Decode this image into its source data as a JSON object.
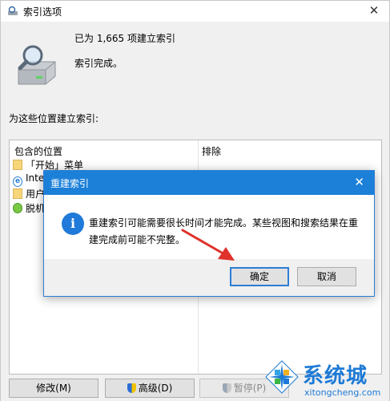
{
  "window": {
    "title": "索引选项",
    "close_glyph": "✕"
  },
  "index": {
    "count_text": "已为 1,665 项建立索引",
    "status_text": "索引完成。",
    "locations_heading": "为这些位置建立索引:"
  },
  "table": {
    "headers": {
      "included": "包含的位置",
      "excluded": "排除"
    },
    "rows": [
      {
        "icon": "folder-icon",
        "label": "「开始」菜单"
      },
      {
        "icon": "internet-explorer-icon",
        "label": "Inter"
      },
      {
        "icon": "folder-icon",
        "label": "用户"
      },
      {
        "icon": "offline-files-icon",
        "label": "脱机"
      }
    ]
  },
  "buttons": {
    "modify": "修改(M)",
    "advanced": "高级(D)",
    "pause": "暂停(P)"
  },
  "dialog": {
    "title": "重建索引",
    "close_glyph": "✕",
    "message": "重建索引可能需要很长时间才能完成。某些视图和搜索结果在重建完成前可能不完整。",
    "ok": "确定",
    "cancel": "取消"
  },
  "watermark": {
    "brand": "系统城",
    "domain": "xitongcheng.com"
  },
  "colors": {
    "dialog_titlebar": "#1c80d9",
    "accent": "#2d7cd6",
    "annotation_arrow": "#e0312b",
    "watermark": "#1d7ad6"
  }
}
